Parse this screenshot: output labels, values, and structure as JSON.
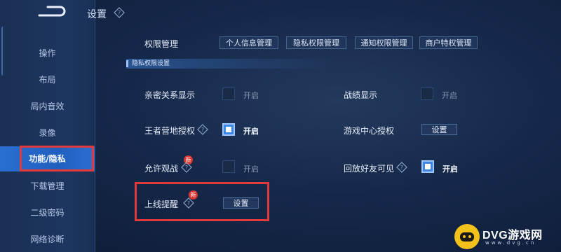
{
  "page": {
    "title": "设置"
  },
  "sidebar": {
    "items": [
      {
        "label": "操作"
      },
      {
        "label": "布局"
      },
      {
        "label": "局内音效"
      },
      {
        "label": "录像"
      },
      {
        "label": "功能/隐私",
        "active": true
      },
      {
        "label": "下载管理"
      },
      {
        "label": "二级密码"
      },
      {
        "label": "网络诊断"
      }
    ]
  },
  "permissions": {
    "label": "权限管理",
    "tabs": [
      {
        "label": "个人信息管理"
      },
      {
        "label": "隐私权限管理"
      },
      {
        "label": "通知权限管理"
      },
      {
        "label": "商户特权管理"
      }
    ]
  },
  "section": {
    "header": "隐私权限设置"
  },
  "settings": {
    "intimacy": {
      "label": "亲密关系显示",
      "state": "开启",
      "checked": false
    },
    "record": {
      "label": "战绩显示",
      "state": "开启",
      "checked": false
    },
    "camp": {
      "label": "王者营地授权",
      "state": "开启",
      "checked": true
    },
    "game_center": {
      "label": "游戏中心授权",
      "button": "设置"
    },
    "spectate": {
      "label": "允许观战",
      "state": "开启",
      "checked": false,
      "badge": "新"
    },
    "replay": {
      "label": "回放好友可见",
      "state": "开启",
      "checked": true
    },
    "online_alert": {
      "label": "上线提醒",
      "button": "设置",
      "badge": "新"
    }
  },
  "watermark": {
    "brand": "DVG游戏网",
    "url": "www.dvg.cn"
  },
  "colors": {
    "accent": "#2a6fd0",
    "highlight_box": "#e03a3a",
    "badge": "#d8362e"
  }
}
